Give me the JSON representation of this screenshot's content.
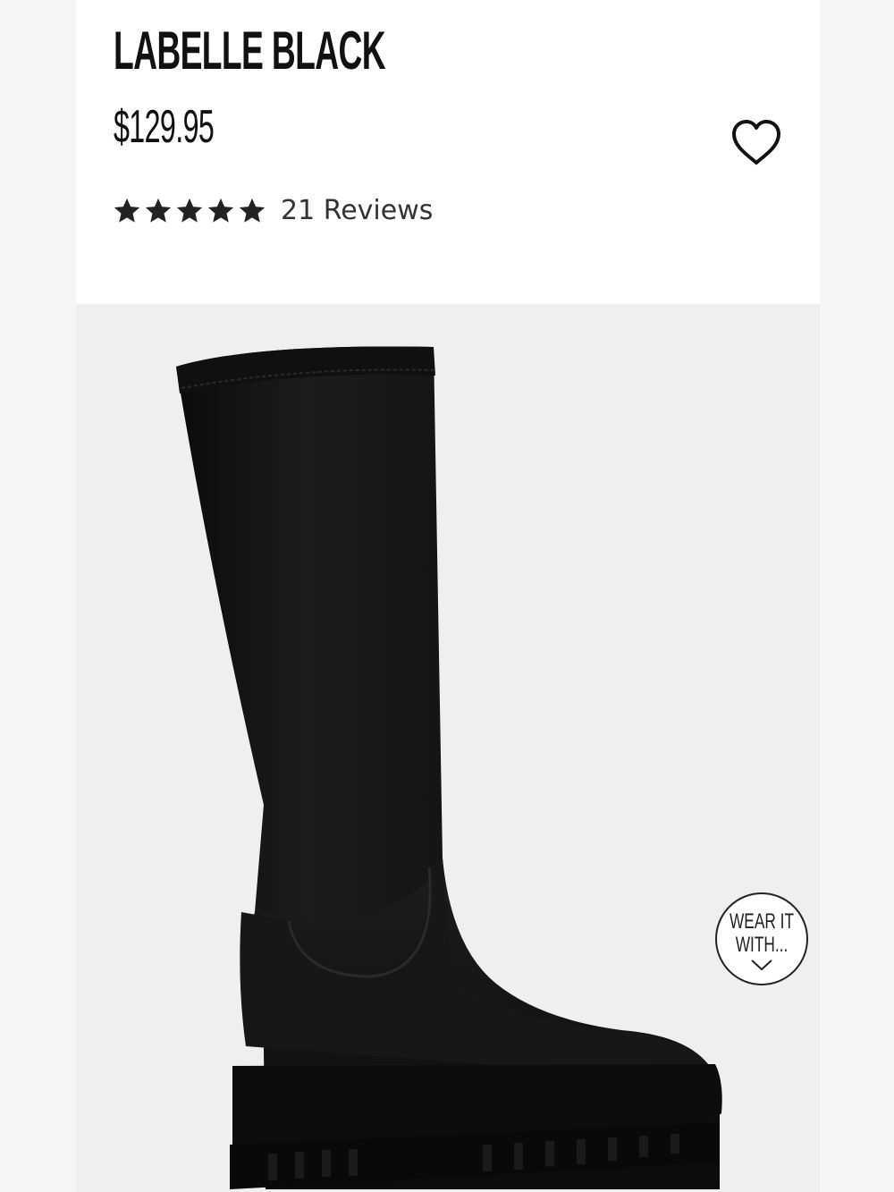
{
  "product": {
    "title": "LABELLE BLACK",
    "price": "$129.95",
    "rating": 5,
    "reviews_label": "21 Reviews"
  },
  "wishlist": {
    "icon": "heart-outline-icon"
  },
  "wear_it_with": {
    "label": "WEAR IT\nWITH...",
    "icon": "chevron-down-icon"
  },
  "colors": {
    "text": "#111111",
    "page_bg": "#ffffff",
    "image_bg": "#efefef",
    "boot": "#141414"
  }
}
